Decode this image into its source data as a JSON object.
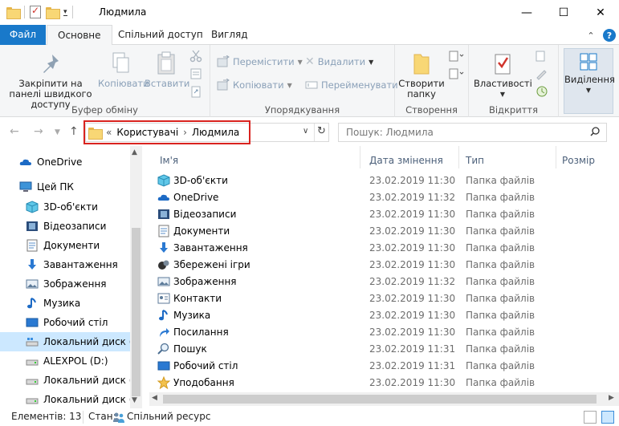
{
  "window": {
    "title": "Людмила",
    "minimize_glyph": "—",
    "maximize_glyph": "☐",
    "close_glyph": "✕"
  },
  "tabs": {
    "file": "Файл",
    "home": "Основне",
    "share": "Спільний доступ",
    "view": "Вигляд",
    "collapse_glyph": "⌃",
    "help_glyph": "?"
  },
  "ribbon": {
    "clipboard": {
      "label": "Буфер обміну",
      "pin": "Закріпити на панелі швидкого доступу",
      "copy": "Копіювати",
      "paste": "Вставити"
    },
    "organize": {
      "label": "Упорядкування",
      "move_to": "Перемістити",
      "copy_to": "Копіювати",
      "delete": "Видалити",
      "rename": "Перейменувати"
    },
    "new": {
      "label": "Створення",
      "new_folder": "Створити папку"
    },
    "open": {
      "label": "Відкриття",
      "properties": "Властивості"
    },
    "select": {
      "label": "Виділення"
    }
  },
  "address": {
    "overflow": "«",
    "crumb1": "Користувачі",
    "separator": "›",
    "crumb2": "Людмила",
    "search_placeholder": "Пошук: Людмила"
  },
  "nav": {
    "items": [
      {
        "label": "OneDrive",
        "icon": "onedrive-icon"
      },
      {
        "label": "Цей ПК",
        "icon": "this-pc-icon"
      },
      {
        "label": "3D-об'єкти",
        "icon": "3d-objects-icon"
      },
      {
        "label": "Відеозаписи",
        "icon": "videos-icon"
      },
      {
        "label": "Документи",
        "icon": "documents-icon"
      },
      {
        "label": "Завантаження",
        "icon": "downloads-icon"
      },
      {
        "label": "Зображення",
        "icon": "pictures-icon"
      },
      {
        "label": "Музика",
        "icon": "music-icon"
      },
      {
        "label": "Робочий стіл",
        "icon": "desktop-icon"
      },
      {
        "label": "Локальний диск (C:",
        "icon": "drive-icon"
      },
      {
        "label": "ALEXPOL (D:)",
        "icon": "drive-icon"
      },
      {
        "label": "Локальний диск (E:)",
        "icon": "drive-icon"
      },
      {
        "label": "Локальний диск (F:)",
        "icon": "drive-icon"
      }
    ]
  },
  "columns": {
    "name": "Ім'я",
    "date": "Дата змінення",
    "type": "Тип",
    "size": "Розмір"
  },
  "files": [
    {
      "name": "3D-об'єкти",
      "date": "23.02.2019 11:30",
      "type": "Папка файлів",
      "icon": "3d-objects-icon"
    },
    {
      "name": "OneDrive",
      "date": "23.02.2019 11:32",
      "type": "Папка файлів",
      "icon": "onedrive-icon"
    },
    {
      "name": "Відеозаписи",
      "date": "23.02.2019 11:30",
      "type": "Папка файлів",
      "icon": "videos-icon"
    },
    {
      "name": "Документи",
      "date": "23.02.2019 11:30",
      "type": "Папка файлів",
      "icon": "documents-icon"
    },
    {
      "name": "Завантаження",
      "date": "23.02.2019 11:30",
      "type": "Папка файлів",
      "icon": "downloads-icon"
    },
    {
      "name": "Збережені ігри",
      "date": "23.02.2019 11:30",
      "type": "Папка файлів",
      "icon": "saved-games-icon"
    },
    {
      "name": "Зображення",
      "date": "23.02.2019 11:32",
      "type": "Папка файлів",
      "icon": "pictures-icon"
    },
    {
      "name": "Контакти",
      "date": "23.02.2019 11:30",
      "type": "Папка файлів",
      "icon": "contacts-icon"
    },
    {
      "name": "Музика",
      "date": "23.02.2019 11:30",
      "type": "Папка файлів",
      "icon": "music-icon"
    },
    {
      "name": "Посилання",
      "date": "23.02.2019 11:30",
      "type": "Папка файлів",
      "icon": "links-icon"
    },
    {
      "name": "Пошук",
      "date": "23.02.2019 11:31",
      "type": "Папка файлів",
      "icon": "search-icon"
    },
    {
      "name": "Робочий стіл",
      "date": "23.02.2019 11:31",
      "type": "Папка файлів",
      "icon": "desktop-icon"
    },
    {
      "name": "Уподобання",
      "date": "23.02.2019 11:30",
      "type": "Папка файлів",
      "icon": "favorites-icon"
    }
  ],
  "status": {
    "count": "Елементів: 13",
    "state_label": "Стан:",
    "state_value": "Спільний ресурс"
  },
  "colors": {
    "accent": "#1979ca",
    "selection": "#cce8ff",
    "highlight_border": "#d9231f",
    "folder_yellow": "#f8d775"
  }
}
